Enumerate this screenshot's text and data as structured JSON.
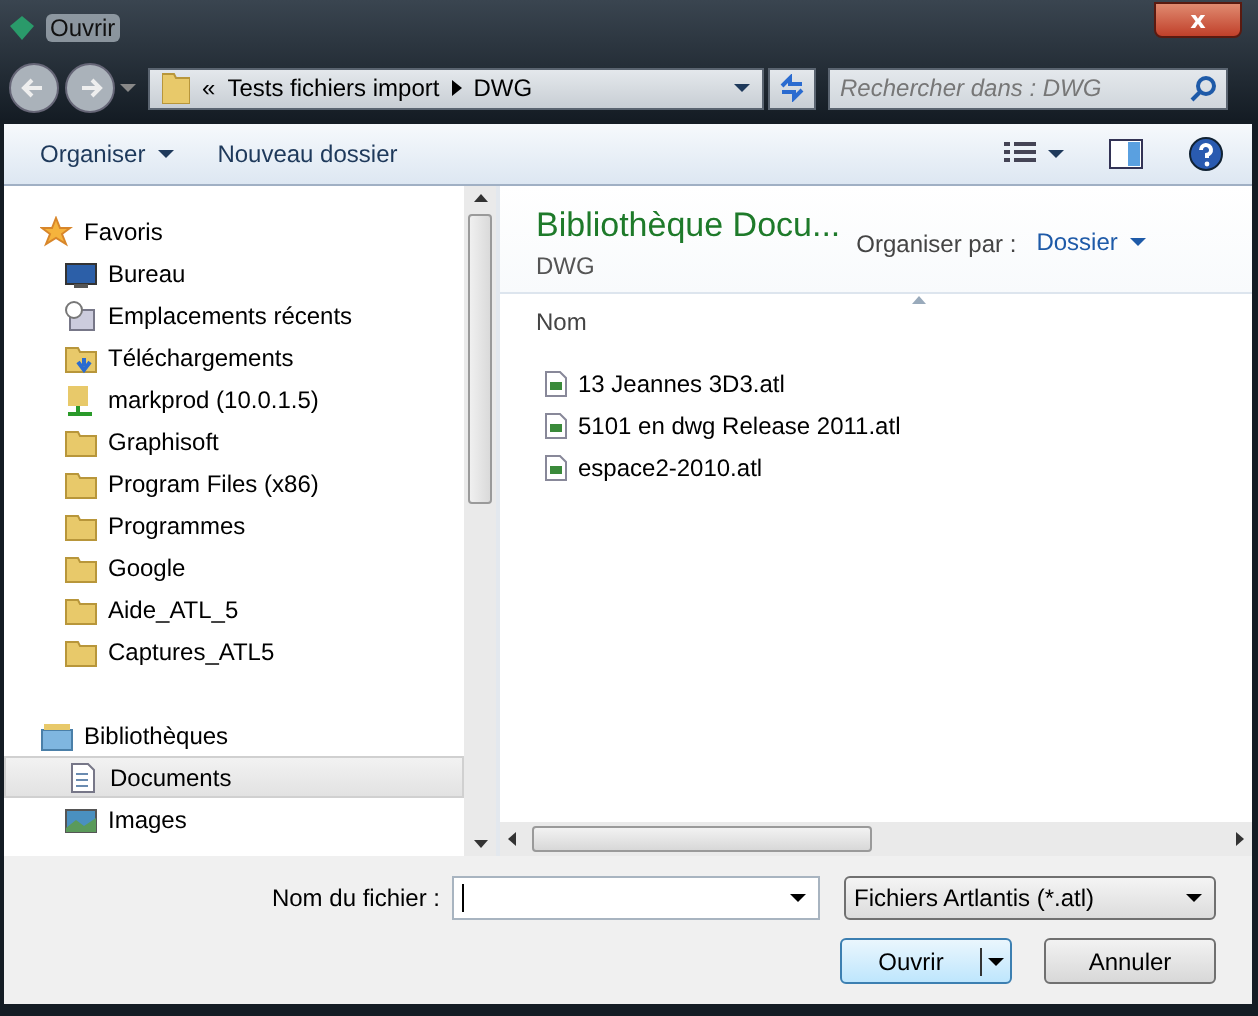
{
  "window": {
    "title": "Ouvrir",
    "close": "x"
  },
  "address_bar": {
    "overflow": "«",
    "path": [
      "Tests fichiers import",
      "DWG"
    ]
  },
  "search": {
    "placeholder": "Rechercher dans : DWG"
  },
  "toolbar": {
    "organize": "Organiser",
    "new_folder": "Nouveau dossier"
  },
  "sidebar": {
    "groups": [
      {
        "label": "Favoris",
        "kind": "star",
        "items": [
          {
            "label": "Bureau",
            "kind": "desktop",
            "selected": false
          },
          {
            "label": "Emplacements récents",
            "kind": "recent",
            "selected": false
          },
          {
            "label": "Téléchargements",
            "kind": "downloads",
            "selected": false
          },
          {
            "label": "markprod (10.0.1.5)",
            "kind": "network",
            "selected": false
          },
          {
            "label": "Graphisoft",
            "kind": "folder",
            "selected": false
          },
          {
            "label": "Program Files (x86)",
            "kind": "folder",
            "selected": false
          },
          {
            "label": "Programmes",
            "kind": "folder",
            "selected": false
          },
          {
            "label": "Google",
            "kind": "folder",
            "selected": false
          },
          {
            "label": "Aide_ATL_5",
            "kind": "folder",
            "selected": false
          },
          {
            "label": "Captures_ATL5",
            "kind": "folder",
            "selected": false
          }
        ]
      },
      {
        "label": "Bibliothèques",
        "kind": "library",
        "items": [
          {
            "label": "Documents",
            "kind": "document",
            "selected": true
          },
          {
            "label": "Images",
            "kind": "image",
            "selected": false
          }
        ]
      }
    ]
  },
  "content": {
    "title": "Bibliothèque Docu...",
    "subtitle": "DWG",
    "arrange_label": "Organiser par :",
    "arrange_value": "Dossier",
    "column": "Nom",
    "files": [
      {
        "name": "13 Jeannes 3D3.atl"
      },
      {
        "name": "5101 en dwg Release 2011.atl"
      },
      {
        "name": "espace2-2010.atl"
      }
    ]
  },
  "footer": {
    "filename_label": "Nom du fichier :",
    "filetype": "Fichiers Artlantis (*.atl)",
    "buttons": [
      {
        "label": "Ouvrir",
        "kind": "split"
      },
      {
        "label": "Annuler",
        "kind": "plain"
      }
    ]
  }
}
